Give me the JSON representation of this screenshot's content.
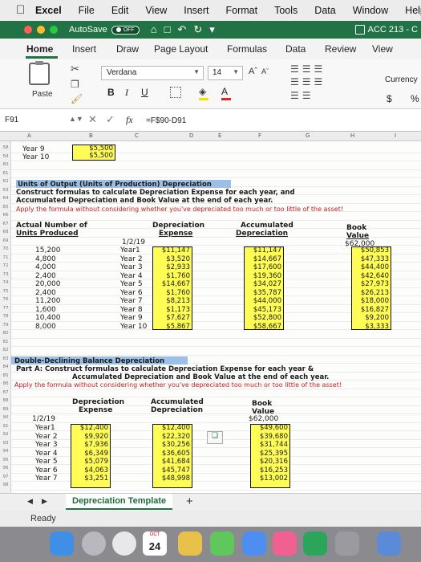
{
  "menubar": {
    "app_name": "Excel",
    "items": [
      "File",
      "Edit",
      "View",
      "Insert",
      "Format",
      "Tools",
      "Data",
      "Window",
      "Help"
    ]
  },
  "titlebar": {
    "autosave_label": "AutoSave",
    "autosave_state": "OFF",
    "doc_title": "ACC 213 - C"
  },
  "ribbon": {
    "tabs": [
      "Home",
      "Insert",
      "Draw",
      "Page Layout",
      "Formulas",
      "Data",
      "Review",
      "View"
    ],
    "paste_label": "Paste",
    "font_name": "Verdana",
    "font_size": "14",
    "bold": "B",
    "italic": "I",
    "underline": "U",
    "number_format": "Currency",
    "currency_symbol": "$",
    "percent_symbol": "%"
  },
  "formula_bar": {
    "cell_ref": "F91",
    "formula": "=F$90-D91"
  },
  "columns": [
    "A",
    "B",
    "C",
    "D",
    "E",
    "F",
    "G",
    "H",
    "I"
  ],
  "sheet": {
    "row_numbers": [
      "58",
      "59",
      "60",
      "61",
      "62",
      "63",
      "64",
      "65",
      "66",
      "67",
      "68",
      "69",
      "70",
      "71",
      "72",
      "73",
      "74",
      "75",
      "76",
      "77",
      "78",
      "79",
      "80",
      "81",
      "82",
      "83",
      "84",
      "85",
      "86",
      "87",
      "88",
      "89",
      "90",
      "91",
      "92",
      "93",
      "94",
      "95",
      "96",
      "97",
      "98"
    ],
    "top_rows": [
      {
        "label": "Year 9",
        "value": "$5,500"
      },
      {
        "label": "Year 10",
        "value": "$5,500"
      }
    ],
    "uop": {
      "title": "Units of Output (Units of Production) Depreciation",
      "instr1": "Construct formulas to calculate Depreciation Expense for each year, and",
      "instr2": "Accumulated Depreciation and Book Value at the end of each year.",
      "instr3": "Apply the formula without considering whether you've depreciated too much or too little of the asset!",
      "hdr_actual1": "Actual Number of",
      "hdr_actual2": "Units Produced",
      "hdr_dep1": "Depreciation",
      "hdr_dep2": "Expense",
      "hdr_acc1": "Accumulated",
      "hdr_acc2": "Depreciation",
      "hdr_book1": "Book",
      "hdr_book2": "Value",
      "start_date": "1/2/19",
      "start_book": "$62,000",
      "rows": [
        {
          "units": "15,200",
          "year": "Year1",
          "exp": "$11,147",
          "acc": "$11,147",
          "book": "$50,853"
        },
        {
          "units": "4,800",
          "year": "Year 2",
          "exp": "$3,520",
          "acc": "$14,667",
          "book": "$47,333"
        },
        {
          "units": "4,000",
          "year": "Year 3",
          "exp": "$2,933",
          "acc": "$17,600",
          "book": "$44,400"
        },
        {
          "units": "2,400",
          "year": "Year 4",
          "exp": "$1,760",
          "acc": "$19,360",
          "book": "$42,640"
        },
        {
          "units": "20,000",
          "year": "Year 5",
          "exp": "$14,667",
          "acc": "$34,027",
          "book": "$27,973"
        },
        {
          "units": "2,400",
          "year": "Year 6",
          "exp": "$1,760",
          "acc": "$35,787",
          "book": "$26,213"
        },
        {
          "units": "11,200",
          "year": "Year 7",
          "exp": "$8,213",
          "acc": "$44,000",
          "book": "$18,000"
        },
        {
          "units": "1,600",
          "year": "Year 8",
          "exp": "$1,173",
          "acc": "$45,173",
          "book": "$16,827"
        },
        {
          "units": "10,400",
          "year": "Year 9",
          "exp": "$7,627",
          "acc": "$52,800",
          "book": "$9,200"
        },
        {
          "units": "8,000",
          "year": "Year 10",
          "exp": "$5,867",
          "acc": "$58,667",
          "book": "$3,333"
        }
      ]
    },
    "ddb": {
      "title": "Double-Declining Balance Depreciation",
      "instr1": "Part A: Construct formulas to calculate Depreciation Expense for each year &",
      "instr2": "Accumulated Depreciation and Book Value at the end of each year.",
      "instr3": "Apply the formula without considering whether you've depreciated too much or too little of the asset!",
      "hdr_dep1": "Depreciation",
      "hdr_dep2": "Expense",
      "hdr_acc1": "Accumulated",
      "hdr_acc2": "Depreciation",
      "hdr_book1": "Book",
      "hdr_book2": "Value",
      "start_date": "1/2/19",
      "start_book": "$62,000",
      "rows": [
        {
          "year": "Year1",
          "exp": "$12,400",
          "acc": "$12,400",
          "book": "$49,600"
        },
        {
          "year": "Year 2",
          "exp": "$9,920",
          "acc": "$22,320",
          "book": "$39,680"
        },
        {
          "year": "Year 3",
          "exp": "$7,936",
          "acc": "$30,256",
          "book": "$31,744"
        },
        {
          "year": "Year 4",
          "exp": "$6,349",
          "acc": "$36,605",
          "book": "$25,395"
        },
        {
          "year": "Year 5",
          "exp": "$5,079",
          "acc": "$41,684",
          "book": "$20,316"
        },
        {
          "year": "Year 6",
          "exp": "$4,063",
          "acc": "$45,747",
          "book": "$16,253"
        },
        {
          "year": "Year 7",
          "exp": "$3,251",
          "acc": "$48,998",
          "book": "$13,002"
        }
      ]
    }
  },
  "sheet_tab": "Depreciation Template",
  "status": "Ready",
  "dock": {
    "calendar_month": "OCT",
    "calendar_day": "24"
  },
  "colors": {
    "excel_green": "#217346",
    "highlight_yellow": "#fffd55",
    "section_blue": "#9bbfe5",
    "instruction_red": "#c41e1e"
  }
}
